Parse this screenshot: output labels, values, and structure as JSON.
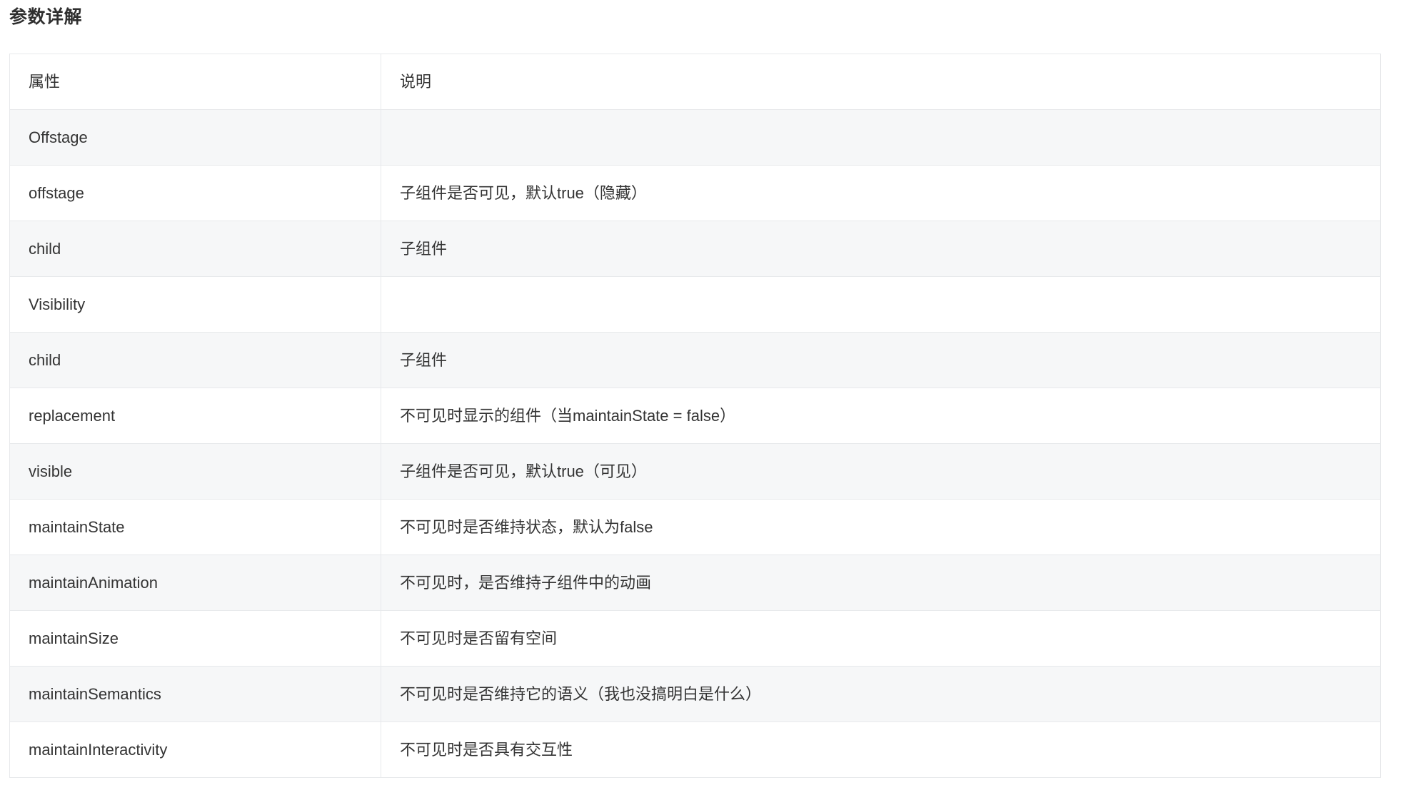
{
  "page": {
    "heading": "参数详解"
  },
  "table": {
    "columns": [
      "属性",
      "说明"
    ],
    "rows": [
      {
        "kind": "section",
        "attr": "Offstage",
        "desc": ""
      },
      {
        "kind": "data",
        "attr": "offstage",
        "desc": "子组件是否可见，默认true（隐藏）"
      },
      {
        "kind": "data",
        "attr": "child",
        "desc": "子组件"
      },
      {
        "kind": "section",
        "attr": "Visibility",
        "desc": ""
      },
      {
        "kind": "data",
        "attr": "child",
        "desc": "子组件"
      },
      {
        "kind": "data",
        "attr": "replacement",
        "desc": "不可见时显示的组件（当maintainState = false）"
      },
      {
        "kind": "data",
        "attr": "visible",
        "desc": "子组件是否可见，默认true（可见）"
      },
      {
        "kind": "data",
        "attr": "maintainState",
        "desc": "不可见时是否维持状态，默认为false"
      },
      {
        "kind": "data",
        "attr": "maintainAnimation",
        "desc": "不可见时，是否维持子组件中的动画"
      },
      {
        "kind": "data",
        "attr": "maintainSize",
        "desc": "不可见时是否留有空间"
      },
      {
        "kind": "data",
        "attr": "maintainSemantics",
        "desc": "不可见时是否维持它的语义（我也没搞明白是什么）"
      },
      {
        "kind": "data",
        "attr": "maintainInteractivity",
        "desc": "不可见时是否具有交互性"
      }
    ]
  },
  "colors": {
    "section_header": "#e8392e",
    "text": "#333333",
    "row_alt": "#f6f7f8",
    "border": "#e7e9eb"
  }
}
